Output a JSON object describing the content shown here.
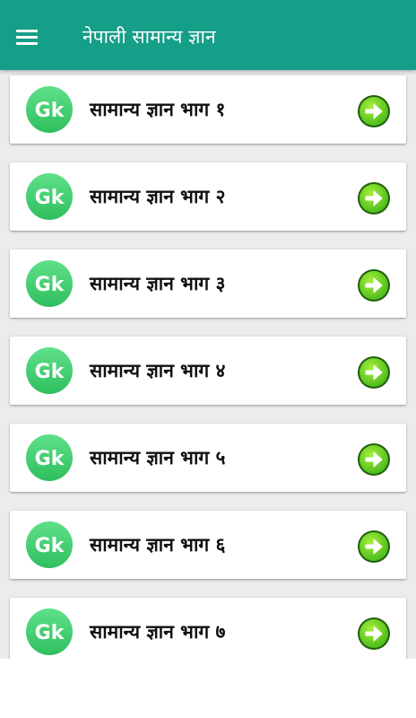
{
  "app_bar": {
    "title": "नेपाली सामान्य ज्ञान",
    "menu_icon": "hamburger-menu-icon",
    "background_color": "#159e88"
  },
  "list": {
    "icon_text": "Gk",
    "icon_colors": {
      "light": "#5fe08a",
      "dark": "#2fbf5e"
    },
    "arrow_icon": "arrow-right-circle-icon",
    "arrow_colors": {
      "light": "#a6ef3a",
      "dark": "#47b81a"
    },
    "items": [
      {
        "label": "सामान्य ज्ञान भाग १"
      },
      {
        "label": "सामान्य ज्ञान भाग २"
      },
      {
        "label": "सामान्य ज्ञान भाग ३"
      },
      {
        "label": "सामान्य ज्ञान भाग ४"
      },
      {
        "label": "सामान्य ज्ञान भाग ५"
      },
      {
        "label": "सामान्य ज्ञान भाग ६"
      },
      {
        "label": "सामान्य ज्ञान भाग ७"
      }
    ]
  }
}
